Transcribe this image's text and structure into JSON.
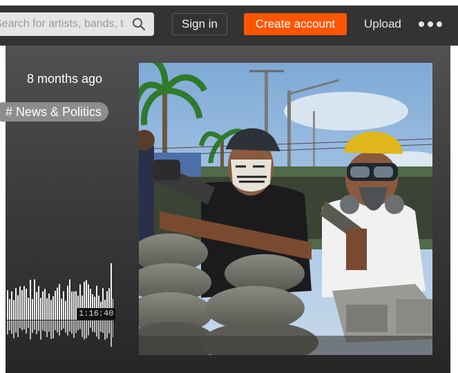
{
  "header": {
    "search_placeholder": "Search for artists, bands, tracks, podcasts",
    "signin_label": "Sign in",
    "create_label": "Create account",
    "upload_label": "Upload",
    "more_icon": "ellipsis-icon",
    "search_icon": "search-icon"
  },
  "track": {
    "posted": "8 months ago",
    "tag": "# News & Politics",
    "duration": "1:16:40",
    "progress": 0
  },
  "colors": {
    "header_bg": "#333333",
    "accent": "#ff5500",
    "tag_bg": "#8d8d8d"
  }
}
